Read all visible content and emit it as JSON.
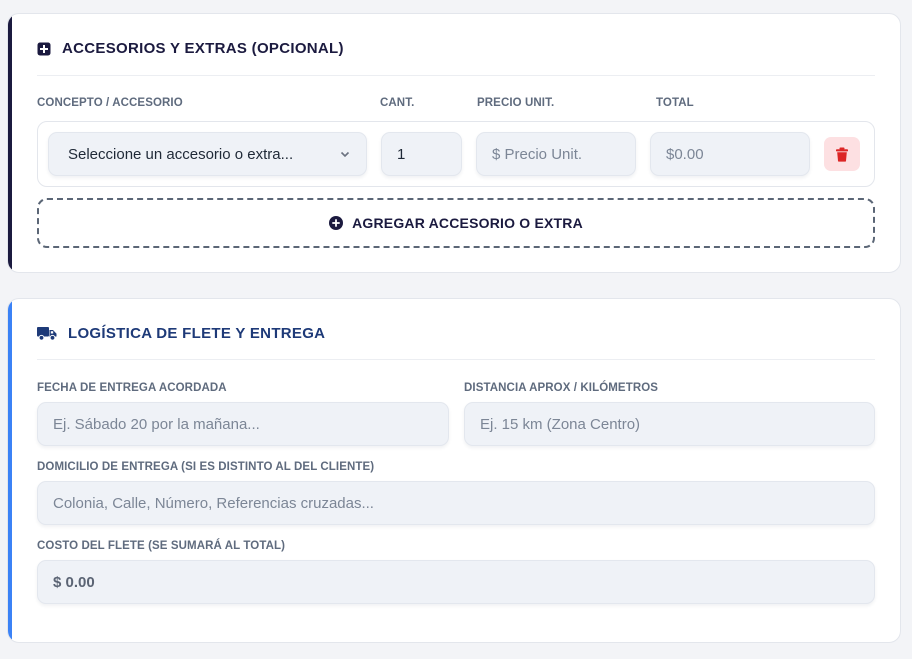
{
  "accessories": {
    "title": "ACCESORIOS Y EXTRAS (OPCIONAL)",
    "title_icon": "plus-square-icon",
    "columns": {
      "concept": "CONCEPTO / ACCESORIO",
      "qty": "CANT.",
      "unit_price": "PRECIO UNIT.",
      "total": "TOTAL"
    },
    "row": {
      "select_value": "Seleccione un accesorio o extra...",
      "qty_value": "1",
      "unit_price_placeholder": "$ Precio Unit.",
      "total_value": "$0.00",
      "delete_icon": "trash-icon"
    },
    "add_button_label": "AGREGAR ACCESORIO O EXTRA",
    "add_button_icon": "plus-circle-icon"
  },
  "logistics": {
    "title": "LOGÍSTICA DE FLETE Y ENTREGA",
    "title_icon": "truck-icon",
    "delivery_date": {
      "label": "FECHA DE ENTREGA ACORDADA",
      "placeholder": "Ej. Sábado 20 por la mañana..."
    },
    "distance": {
      "label": "DISTANCIA APROX / KILÓMETROS",
      "placeholder": "Ej. 15 km (Zona Centro)"
    },
    "address": {
      "label": "DOMICILIO DE ENTREGA (SI ES DISTINTO AL DEL CLIENTE)",
      "placeholder": "Colonia, Calle, Número, Referencias cruzadas..."
    },
    "freight_cost": {
      "label": "COSTO DEL FLETE (SE SUMARÁ AL TOTAL)",
      "value": "$ 0.00"
    }
  },
  "colors": {
    "accent_dark": "#1b1a3f",
    "accent_blue": "#3b82f6",
    "title_blue": "#1e3a78",
    "danger": "#dc2626",
    "danger_bg": "#fde0e2"
  }
}
